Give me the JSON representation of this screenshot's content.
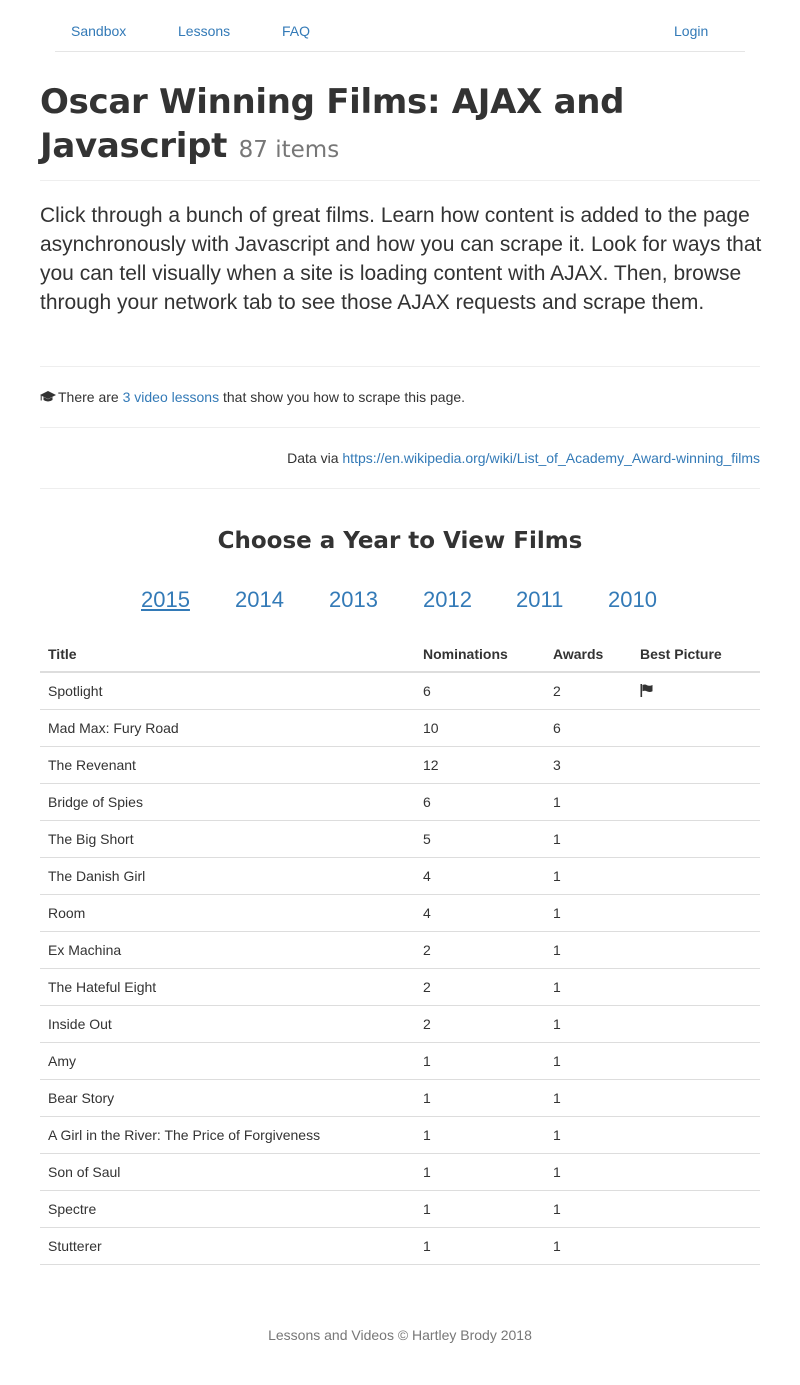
{
  "nav": {
    "sandbox": "Sandbox",
    "lessons": "Lessons",
    "faq": "FAQ",
    "login": "Login"
  },
  "page": {
    "title": "Oscar Winning Films: AJAX and Javascript",
    "count": "87 items"
  },
  "lead": "Click through a bunch of great films. Learn how content is added to the page asynchronously with Javascript and how you can scrape it. Look for ways that you can tell visually when a site is loading content with AJAX. Then, browse through your network tab to see those AJAX requests and scrape them.",
  "lessons_note": {
    "icon": "graduation-cap-icon",
    "prefix": "There are ",
    "link": "3 video lessons",
    "suffix": " that show you how to scrape this page."
  },
  "data_source": {
    "prefix": "Data via ",
    "url": "https://en.wikipedia.org/wiki/List_of_Academy_Award-winning_films"
  },
  "choose_heading": "Choose a Year to View Films",
  "years": [
    "2015",
    "2014",
    "2013",
    "2012",
    "2011",
    "2010"
  ],
  "selected_year": "2015",
  "table": {
    "headers": [
      "Title",
      "Nominations",
      "Awards",
      "Best Picture"
    ],
    "rows": [
      {
        "title": "Spotlight",
        "nominations": "6",
        "awards": "2",
        "best_picture": true
      },
      {
        "title": "Mad Max: Fury Road",
        "nominations": "10",
        "awards": "6",
        "best_picture": false
      },
      {
        "title": "The Revenant",
        "nominations": "12",
        "awards": "3",
        "best_picture": false
      },
      {
        "title": "Bridge of Spies",
        "nominations": "6",
        "awards": "1",
        "best_picture": false
      },
      {
        "title": "The Big Short",
        "nominations": "5",
        "awards": "1",
        "best_picture": false
      },
      {
        "title": "The Danish Girl",
        "nominations": "4",
        "awards": "1",
        "best_picture": false
      },
      {
        "title": "Room",
        "nominations": "4",
        "awards": "1",
        "best_picture": false
      },
      {
        "title": "Ex Machina",
        "nominations": "2",
        "awards": "1",
        "best_picture": false
      },
      {
        "title": "The Hateful Eight",
        "nominations": "2",
        "awards": "1",
        "best_picture": false
      },
      {
        "title": "Inside Out",
        "nominations": "2",
        "awards": "1",
        "best_picture": false
      },
      {
        "title": "Amy",
        "nominations": "1",
        "awards": "1",
        "best_picture": false
      },
      {
        "title": "Bear Story",
        "nominations": "1",
        "awards": "1",
        "best_picture": false
      },
      {
        "title": "A Girl in the River: The Price of Forgiveness",
        "nominations": "1",
        "awards": "1",
        "best_picture": false
      },
      {
        "title": "Son of Saul",
        "nominations": "1",
        "awards": "1",
        "best_picture": false
      },
      {
        "title": "Spectre",
        "nominations": "1",
        "awards": "1",
        "best_picture": false
      },
      {
        "title": "Stutterer",
        "nominations": "1",
        "awards": "1",
        "best_picture": false
      }
    ]
  },
  "footer": "Lessons and Videos © Hartley Brody 2018",
  "colors": {
    "link": "#337ab7",
    "text": "#333333",
    "muted": "#777777"
  }
}
